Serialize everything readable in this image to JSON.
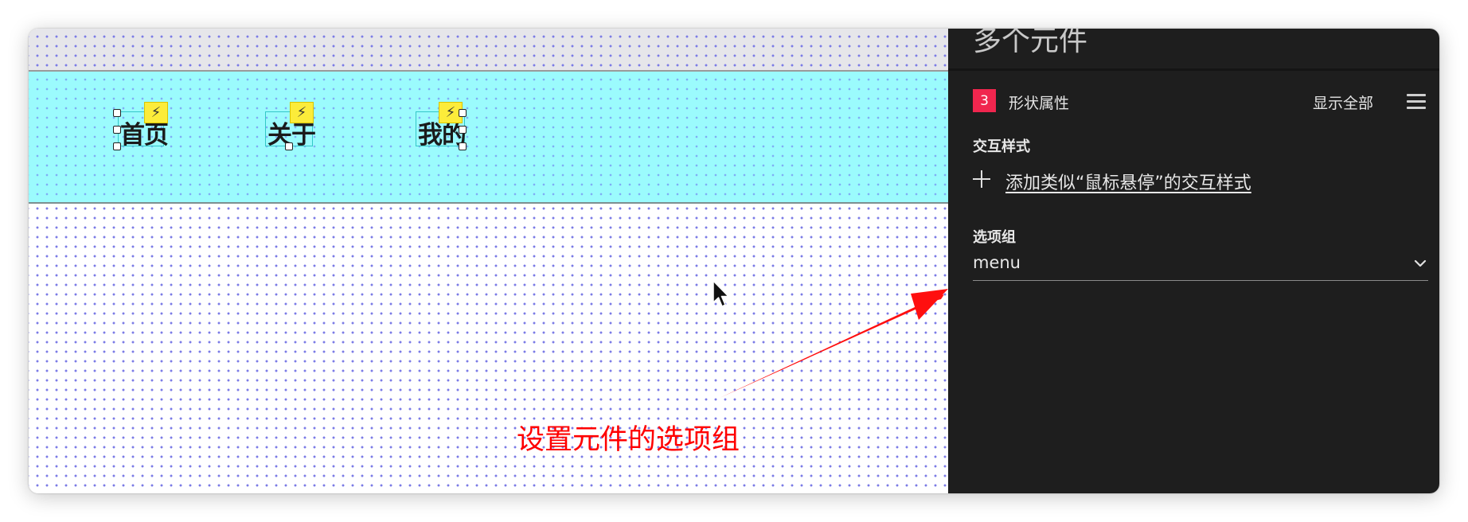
{
  "canvas": {
    "menu_items": [
      {
        "label": "首页",
        "action_icon": "lightning-icon"
      },
      {
        "label": "关于",
        "action_icon": "lightning-icon"
      },
      {
        "label": "我的",
        "action_icon": "lightning-icon"
      }
    ],
    "annotation_text": "设置元件的选项组"
  },
  "inspector": {
    "title": "多个元件",
    "section": {
      "badge": "3",
      "name": "形状属性",
      "show_all_label": "显示全部",
      "menu_icon": "hamburger-icon"
    },
    "interaction_styles": {
      "heading": "交互样式",
      "add_link": "添加类似“鼠标悬停”的交互样式",
      "icon": "plus-icon"
    },
    "option_group": {
      "heading": "选项组",
      "value": "menu",
      "icon": "chevron-down-icon"
    }
  },
  "colors": {
    "menu_band": "#9bfbfd",
    "panel_bg": "#1e1e1e",
    "badge": "#f0264e",
    "annotation": "#ff0000",
    "lightning_badge": "#fcec3a"
  }
}
